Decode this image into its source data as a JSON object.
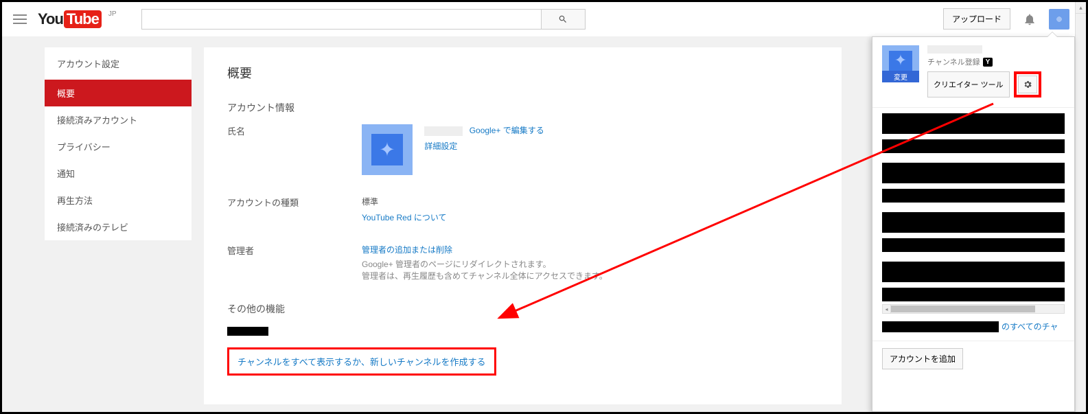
{
  "header": {
    "jp_label": "JP",
    "upload_label": "アップロード"
  },
  "sidebar": {
    "title": "アカウント設定",
    "items": [
      {
        "label": "概要",
        "active": true
      },
      {
        "label": "接続済みアカウント"
      },
      {
        "label": "プライバシー"
      },
      {
        "label": "通知"
      },
      {
        "label": "再生方法"
      },
      {
        "label": "接続済みのテレビ"
      }
    ]
  },
  "main": {
    "page_title": "概要",
    "section_account_info": "アカウント情報",
    "name_label": "氏名",
    "edit_on_gplus": "Google+ で編集する",
    "advanced": "詳細設定",
    "account_type_label": "アカウントの種類",
    "account_type_value": "標準",
    "youtube_red_link": "YouTube Red について",
    "admin_label": "管理者",
    "admin_link": "管理者の追加または削除",
    "admin_desc1": "Google+ 管理者のページにリダイレクトされます。",
    "admin_desc2": "管理者は、再生履歴も含めてチャンネル全体にアクセスできます。",
    "other_title": "その他の機能",
    "channel_link": "チャンネルをすべて表示するか、新しいチャンネルを作成する"
  },
  "panel": {
    "change_label": "変更",
    "sub_text": "チャンネル登録",
    "y_badge": "Y",
    "creator_tool": "クリエイター ツール",
    "all_channels_suffix": "のすべてのチャ",
    "add_account": "アカウントを追加"
  }
}
